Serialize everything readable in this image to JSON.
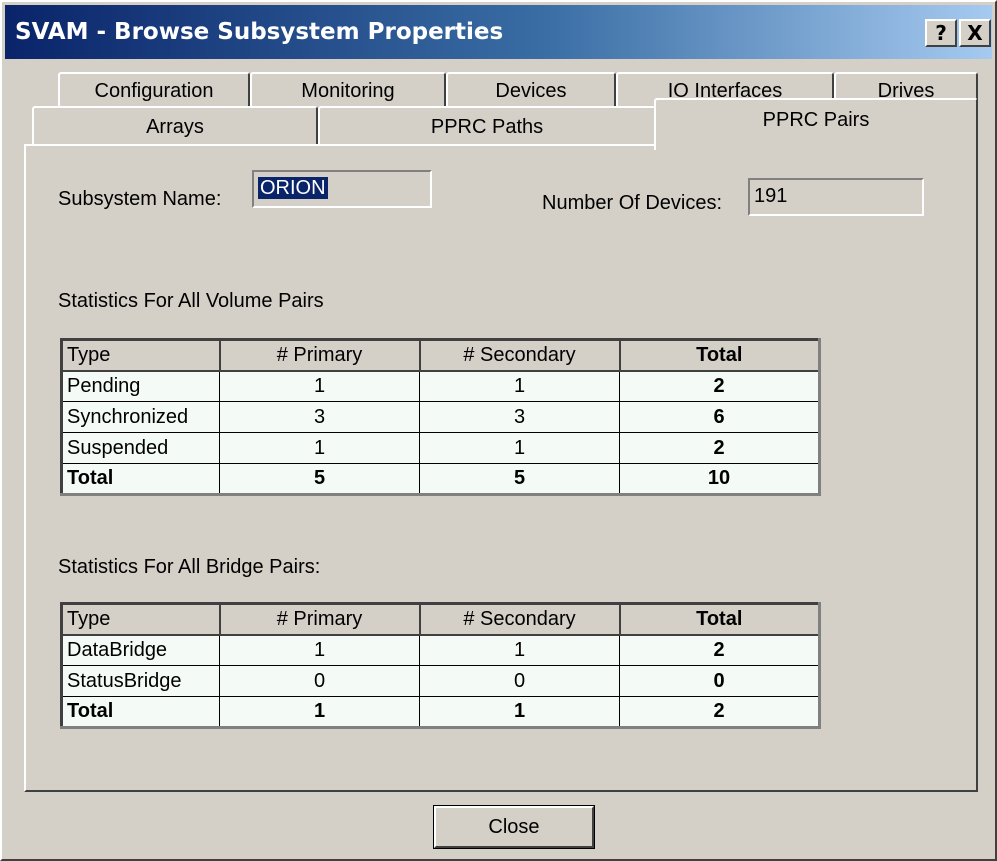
{
  "window": {
    "title": "SVAM - Browse Subsystem Properties",
    "help_label": "?",
    "close_label": "X"
  },
  "tabs": {
    "row1": [
      "Configuration",
      "Monitoring",
      "Devices",
      "IO Interfaces",
      "Drives"
    ],
    "row2": [
      "Arrays",
      "PPRC Paths"
    ],
    "active": "PPRC Pairs"
  },
  "form": {
    "subsystem_name_label": "Subsystem Name:",
    "subsystem_name_value": "ORION",
    "num_devices_label": "Number Of Devices:",
    "num_devices_value": "191"
  },
  "volume_pairs": {
    "title": "Statistics For All Volume Pairs",
    "headers": [
      "Type",
      "# Primary",
      "# Secondary",
      "Total"
    ],
    "rows": [
      [
        "Pending",
        "1",
        "1",
        "2"
      ],
      [
        "Synchronized",
        "3",
        "3",
        "6"
      ],
      [
        "Suspended",
        "1",
        "1",
        "2"
      ],
      [
        "Total",
        "5",
        "5",
        "10"
      ]
    ]
  },
  "bridge_pairs": {
    "title": "Statistics For All Bridge Pairs:",
    "headers": [
      "Type",
      "# Primary",
      "# Secondary",
      "Total"
    ],
    "rows": [
      [
        "DataBridge",
        "1",
        "1",
        "2"
      ],
      [
        "StatusBridge",
        "0",
        "0",
        "0"
      ],
      [
        "Total",
        "1",
        "1",
        "2"
      ]
    ]
  },
  "footer": {
    "close_button": "Close"
  }
}
